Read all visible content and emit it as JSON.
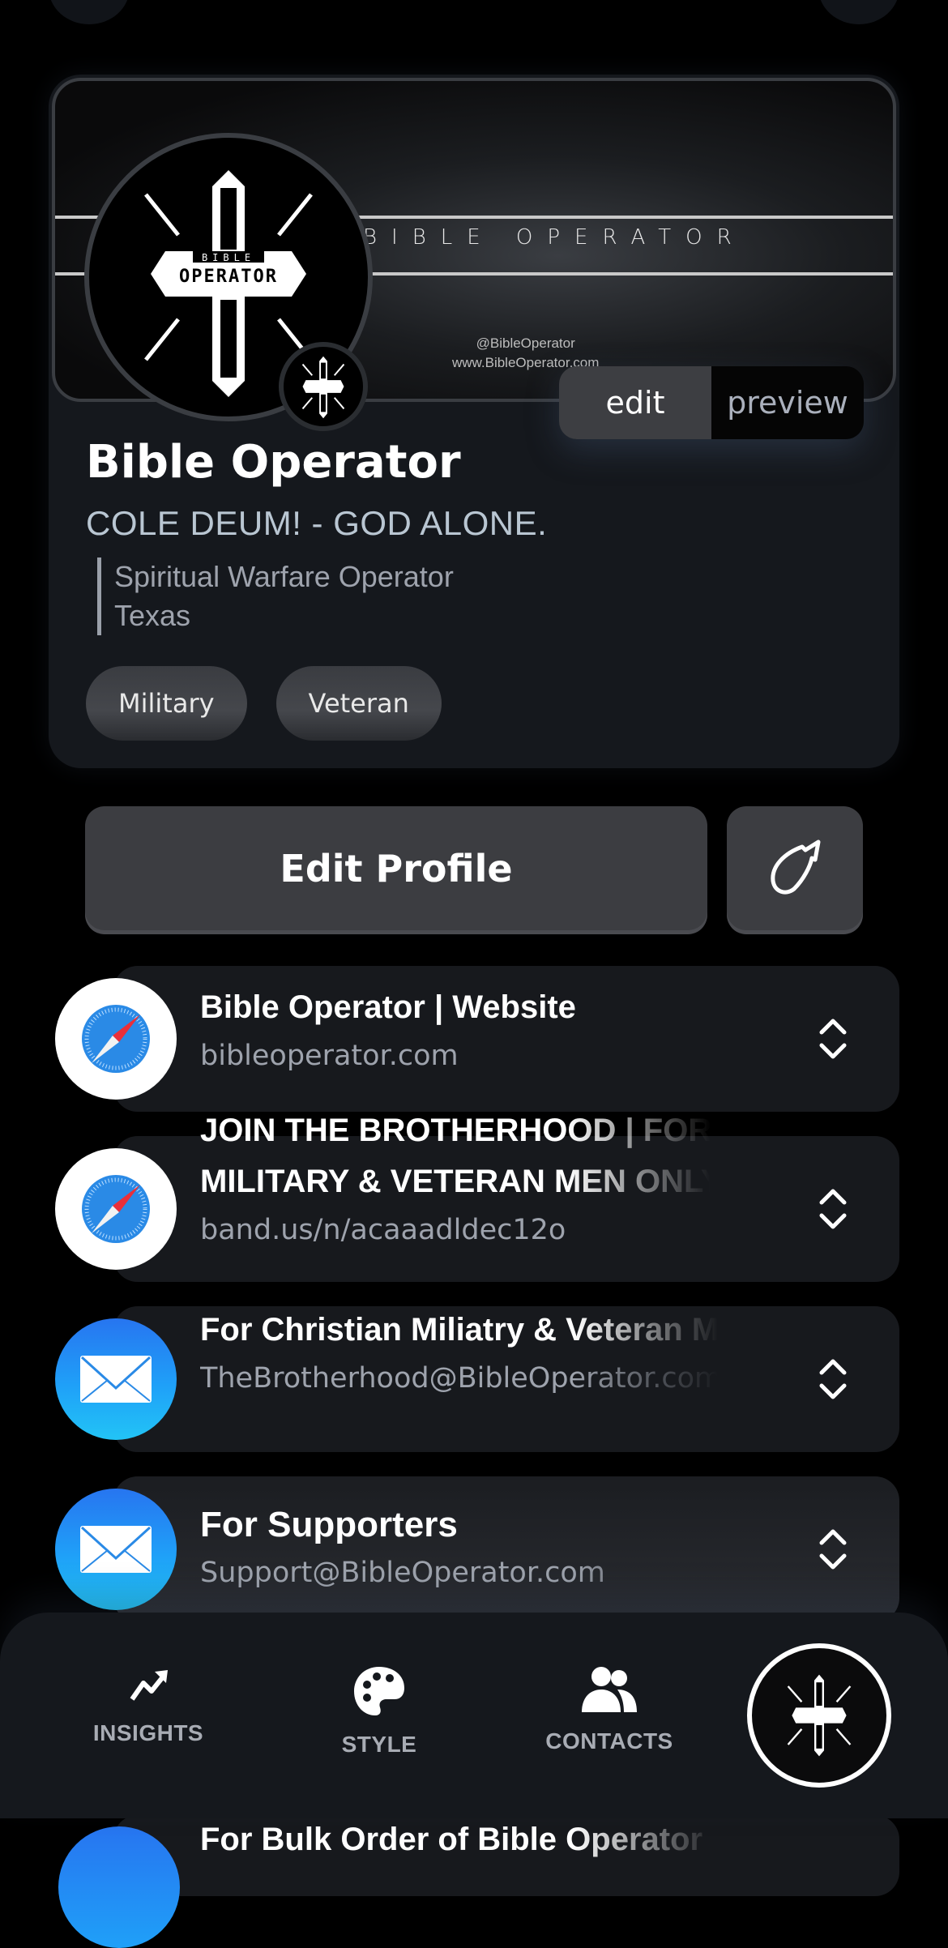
{
  "profile": {
    "banner_title": "BIBLE OPERATOR",
    "banner_handle": "@BibleOperator",
    "banner_site": "www.BibleOperator.com",
    "logo_top": "BIBLE",
    "logo_main": "OPERATOR",
    "name": "Bible Operator",
    "tagline": "COLE DEUM! - GOD ALONE.",
    "bio_line1": "Spiritual Warfare Operator",
    "bio_line2": "Texas",
    "tags": [
      "Military",
      "Veteran"
    ]
  },
  "mode_toggle": {
    "edit": "edit",
    "preview": "preview",
    "active": "edit"
  },
  "actions": {
    "edit_profile": "Edit Profile",
    "side_icon": "bolt-leaf-icon"
  },
  "links": [
    {
      "icon": "safari-icon",
      "title": "Bible Operator | Website",
      "url": "bibleoperator.com"
    },
    {
      "icon": "safari-icon",
      "title": "JOIN THE BROTHERHOOD | FOR CHRISTIAN MILITARY & VETERAN MEN ONLY",
      "url": "band.us/n/acaaadldec12o"
    },
    {
      "icon": "mail-icon",
      "title": "For Christian Miliatry & Veteran Men",
      "url": "TheBrotherhood@BibleOperator.com"
    },
    {
      "icon": "mail-icon",
      "title": "For Supporters",
      "url": "Support@BibleOperator.com"
    },
    {
      "icon": "mail-icon",
      "title": "For Bulk Order of Bible Operator",
      "url": ""
    }
  ],
  "nav": {
    "insights": "INSIGHTS",
    "style": "STYLE",
    "contacts": "CONTACTS"
  },
  "colors": {
    "background": "#000000",
    "card": "#15181d",
    "button": "#3c3d41",
    "mail_blue": "#1fa0f8",
    "muted_text": "#9ea3ad"
  }
}
